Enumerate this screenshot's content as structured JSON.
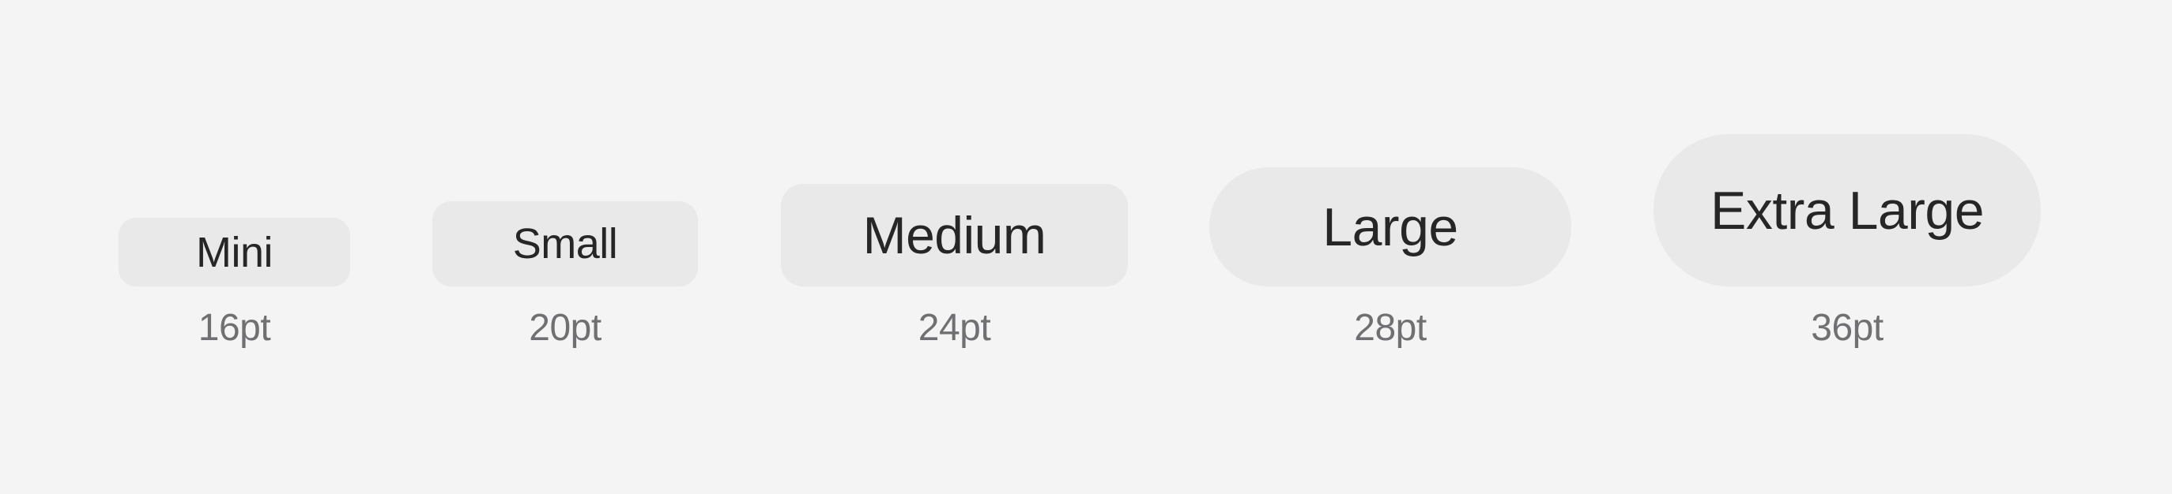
{
  "buttons": [
    {
      "id": "mini",
      "label": "Mini",
      "size": "16pt"
    },
    {
      "id": "small",
      "label": "Small",
      "size": "20pt"
    },
    {
      "id": "medium",
      "label": "Medium",
      "size": "24pt"
    },
    {
      "id": "large",
      "label": "Large",
      "size": "28pt"
    },
    {
      "id": "extra_large",
      "label": "Extra Large",
      "size": "36pt"
    }
  ],
  "colors": {
    "background": "#f4f4f5",
    "button_fill": "#e9e9ea",
    "button_text": "#262626",
    "caption_text": "#707072"
  }
}
